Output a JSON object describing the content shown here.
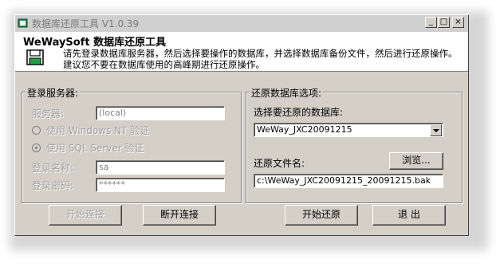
{
  "window": {
    "title": "数据库还原工具 V1.0.39",
    "minimize_glyph": "_",
    "maximize_glyph": "□",
    "close_glyph": "×"
  },
  "header": {
    "title": "WeWaySoft 数据库还原工具",
    "description": "请先登录数据库服务器，然后选择要操作的数据库，并选择数据库备份文件，然后进行还原操作。建议您不要在数据库使用的高峰期进行还原操作。",
    "icon": "floppy-disk-icon"
  },
  "login_group": {
    "label": "登录服务器:",
    "server_label": "服务器:",
    "server_value": "(local)",
    "auth_windows_label": "使用 Windows NT 验证",
    "auth_sql_label": "使用 SQL Server 验证",
    "username_label": "登录名称:",
    "username_value": "sa",
    "password_label": "登录密码:",
    "password_value": "******"
  },
  "restore_group": {
    "label": "还原数据库选项:",
    "db_label": "选择要还原的数据库:",
    "db_value": "WeWay_JXC20091215",
    "file_label": "还原文件名:",
    "browse_label": "浏览...",
    "file_value": "c:\\WeWay_JXC20091215_20091215.bak"
  },
  "buttons": {
    "connect": "开始连接",
    "disconnect": "断开连接",
    "start_restore": "开始还原",
    "exit": "退 出"
  },
  "colors": {
    "window_bg": "#d4d0c8",
    "titlebar_bg": "#cfcfcf",
    "disabled_text": "#a0a0a0"
  }
}
